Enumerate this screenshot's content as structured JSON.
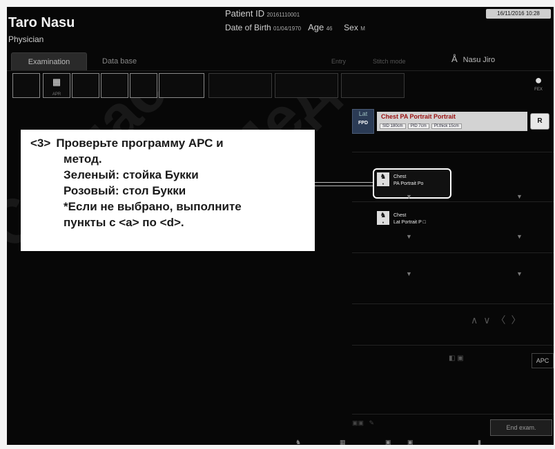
{
  "header": {
    "user_name": "Taro Nasu",
    "role": "Physician",
    "datetime": "16/11/2016 10:28"
  },
  "patient": {
    "id_label": "Patient ID",
    "id_value": "20161110001",
    "dob_label": "Date of Birth",
    "dob_value": "01/04/1970",
    "age_label": "Age",
    "age_value": "46",
    "sex_label": "Sex",
    "sex_value": "M"
  },
  "tabs": [
    {
      "label": "Examination"
    },
    {
      "label": "Data base"
    }
  ],
  "dimmed": [
    "Entry",
    "Stitch mode"
  ],
  "operator": "Nasu Jiro",
  "slots": {
    "active_icon": "grid-icon",
    "active_sub": "APR"
  },
  "rad_icon_label": "FEX",
  "fpd": {
    "top": "Lat",
    "bottom": "FPD"
  },
  "series_header": {
    "title": "Chest  PA Portrait Portrait",
    "sid": "SID 180cm",
    "pid": "PID  7cm",
    "thick": "Pt.thick 15cm",
    "r_button": "R"
  },
  "callout": {
    "tag": "<3>",
    "lines": [
      "Проверьте программу АРС и",
      "метод.",
      "Зеленый: стойка Букки",
      "Розовый: стол Букки",
      "*Если не выбрано, выполните",
      "пункты с <a> по <d>."
    ]
  },
  "thumbs": [
    {
      "line1": "Chest",
      "line2": "PA Portrait Po"
    },
    {
      "line1": "Chest",
      "line2": "Lat Portrait P"
    }
  ],
  "apc_label": "APC",
  "end_exam": "End exam."
}
